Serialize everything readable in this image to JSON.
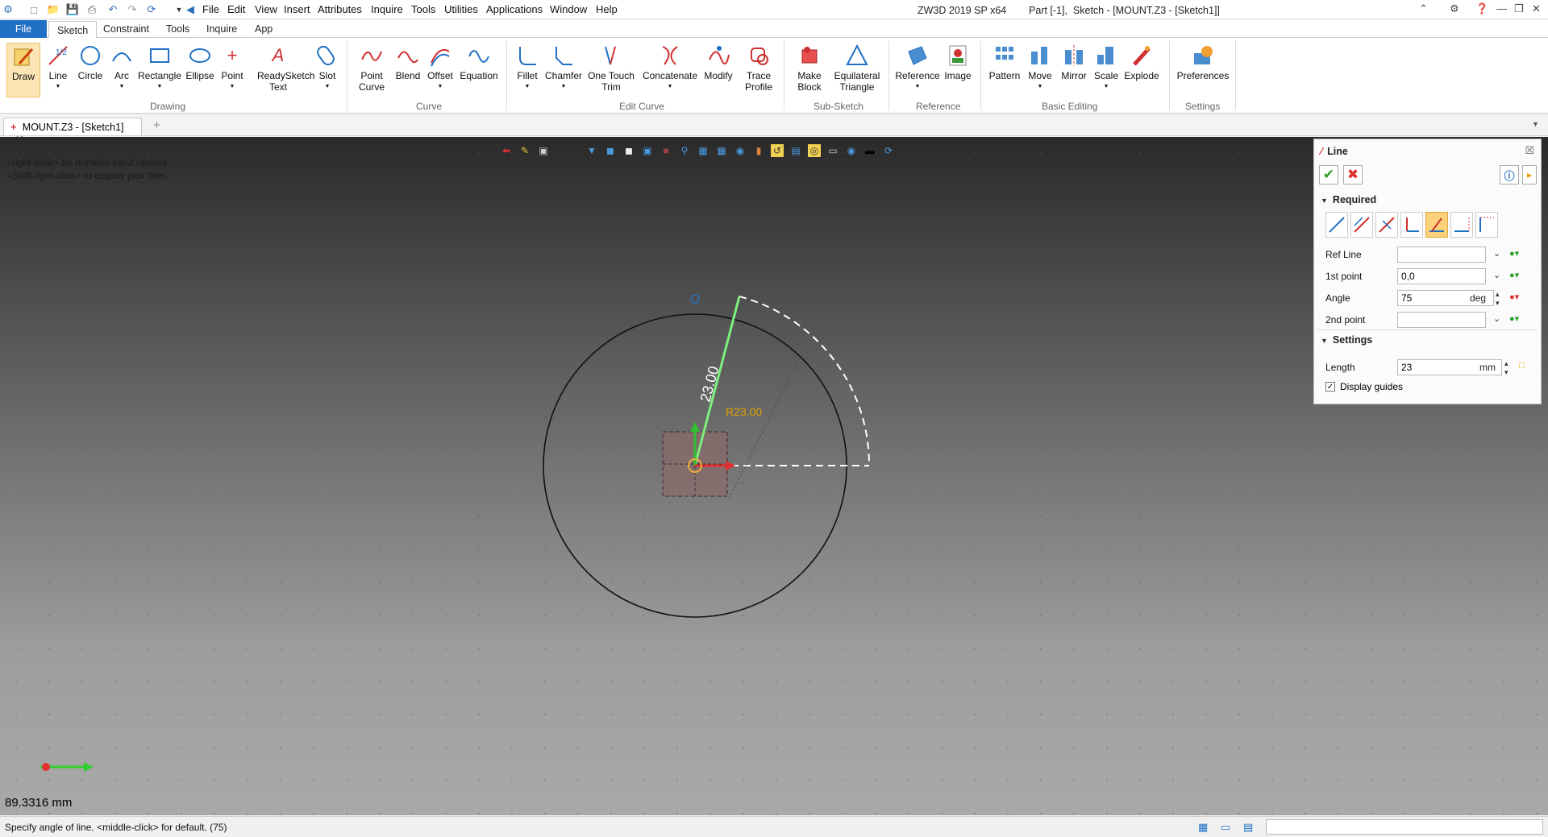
{
  "menu": [
    "File",
    "Edit",
    "View",
    "Insert",
    "Attributes",
    "Inquire",
    "Tools",
    "Utilities",
    "Applications",
    "Window",
    "Help"
  ],
  "title": "ZW3D 2019 SP x64        Part [-1],  Sketch - [MOUNT.Z3 - [Sketch1]]",
  "ribbon_tabs": [
    "File",
    "Sketch",
    "Constraint",
    "Tools",
    "Inquire",
    "App"
  ],
  "ribbon": {
    "drawing": {
      "label": "Drawing",
      "buttons": [
        "Draw",
        "Line",
        "Circle",
        "Arc",
        "Rectangle",
        "Ellipse",
        "Point",
        "ReadySketch Text",
        "Slot"
      ]
    },
    "curve": {
      "label": "Curve",
      "buttons": [
        "Point Curve",
        "Blend",
        "Offset",
        "Equation"
      ]
    },
    "edit_curve": {
      "label": "Edit Curve",
      "buttons": [
        "Fillet",
        "Chamfer",
        "One Touch Trim",
        "Concatenate",
        "Modify",
        "Trace Profile"
      ]
    },
    "sub_sketch": {
      "label": "Sub-Sketch",
      "buttons": [
        "Make Block",
        "Equilateral Triangle"
      ]
    },
    "reference": {
      "label": "Reference",
      "buttons": [
        "Reference",
        "Image"
      ]
    },
    "basic_editing": {
      "label": "Basic Editing",
      "buttons": [
        "Pattern",
        "Move",
        "Mirror",
        "Scale",
        "Explode"
      ]
    },
    "settings": {
      "label": "Settings",
      "buttons": [
        "Preferences"
      ]
    }
  },
  "doc_tab": "MOUNT.Z3 - [Sketch1]",
  "canvas": {
    "hint_line1": "<right-click> for numeric input options.",
    "hint_line2": "<Shift-right-click> to display pick filter.",
    "coord_readout": "89.3316 mm",
    "dim_length": "23.00",
    "dim_radius": "R23.00"
  },
  "panel": {
    "title": "Line",
    "required_label": "Required",
    "fields": {
      "ref_line": {
        "label": "Ref Line",
        "value": ""
      },
      "first_point": {
        "label": "1st point",
        "value": "0,0"
      },
      "angle": {
        "label": "Angle",
        "value": "75",
        "unit": "deg"
      },
      "second_point": {
        "label": "2nd point",
        "value": ""
      }
    },
    "settings_label": "Settings",
    "length": {
      "label": "Length",
      "value": "23",
      "unit": "mm"
    },
    "display_guides": {
      "label": "Display guides",
      "checked": true
    }
  },
  "status": {
    "text": "Specify angle of line.  <middle-click> for default. (75)"
  },
  "colors": {
    "accent": "#1f6fc5",
    "line_green": "#7cf07c",
    "axis_red": "#e53030",
    "dim_orange": "#e0a000"
  }
}
